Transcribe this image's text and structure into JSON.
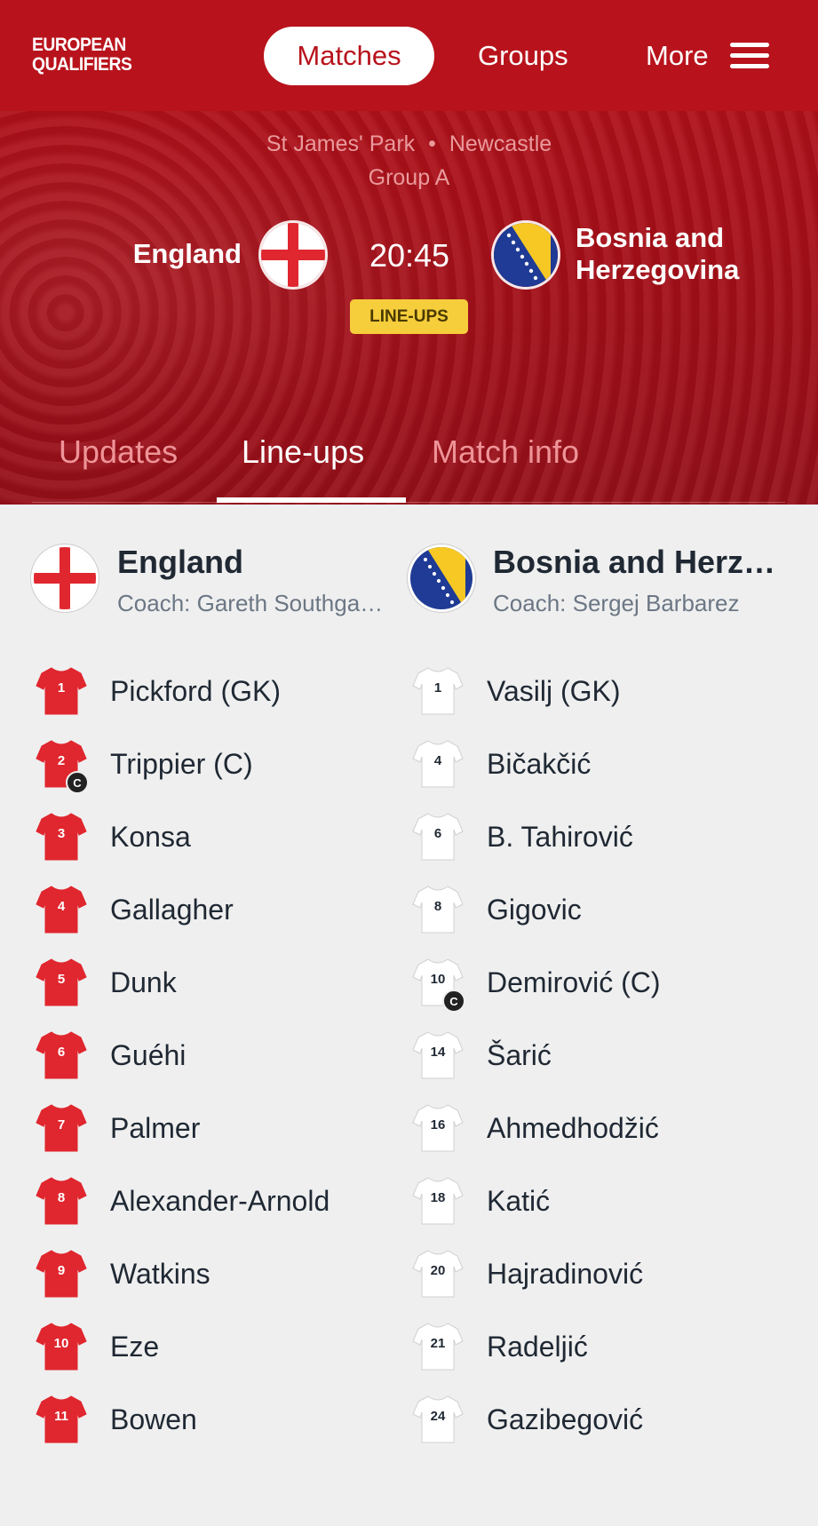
{
  "header": {
    "logo_line1": "EUROPEAN",
    "logo_line2": "QUALIFIERS",
    "nav_matches": "Matches",
    "nav_groups": "Groups",
    "nav_more": "More"
  },
  "match": {
    "stadium": "St James' Park",
    "separator": "•",
    "city": "Newcastle",
    "group": "Group A",
    "home_team": "England",
    "away_team_line1": "Bosnia and",
    "away_team_line2": "Herzegovina",
    "kickoff": "20:45",
    "status_badge": "LINE-UPS"
  },
  "tabs": {
    "updates": "Updates",
    "lineups": "Line-ups",
    "match_info": "Match info"
  },
  "home": {
    "name": "England",
    "coach": "Coach: Gareth Southga…",
    "shirt_color": "#e0262e",
    "number_color": "#ffffff",
    "players": [
      {
        "num": "1",
        "name": "Pickford (GK)"
      },
      {
        "num": "2",
        "name": "Trippier (C)",
        "captain": "C"
      },
      {
        "num": "3",
        "name": "Konsa"
      },
      {
        "num": "4",
        "name": "Gallagher"
      },
      {
        "num": "5",
        "name": "Dunk"
      },
      {
        "num": "6",
        "name": "Guéhi"
      },
      {
        "num": "7",
        "name": "Palmer"
      },
      {
        "num": "8",
        "name": "Alexander-Arnold"
      },
      {
        "num": "9",
        "name": "Watkins"
      },
      {
        "num": "10",
        "name": "Eze"
      },
      {
        "num": "11",
        "name": "Bowen"
      }
    ]
  },
  "away": {
    "name": "Bosnia and Herz…",
    "coach": "Coach: Sergej Barbarez",
    "shirt_color": "#ffffff",
    "number_color": "#1f2833",
    "players": [
      {
        "num": "1",
        "name": "Vasilj (GK)"
      },
      {
        "num": "4",
        "name": "Bičakčić"
      },
      {
        "num": "6",
        "name": "B. Tahirović"
      },
      {
        "num": "8",
        "name": "Gigovic"
      },
      {
        "num": "10",
        "name": "Demirović (C)",
        "captain": "C"
      },
      {
        "num": "14",
        "name": "Šarić"
      },
      {
        "num": "16",
        "name": "Ahmedhodžić"
      },
      {
        "num": "18",
        "name": "Katić"
      },
      {
        "num": "20",
        "name": "Hajradinović"
      },
      {
        "num": "21",
        "name": "Radeljić"
      },
      {
        "num": "24",
        "name": "Gazibegović"
      }
    ]
  },
  "icons": {
    "hamburger": "hamburger-menu-icon",
    "home_flag": "england-flag-icon",
    "away_flag": "bosnia-flag-icon",
    "shirt": "shirt-icon",
    "captain": "captain-badge-icon"
  }
}
